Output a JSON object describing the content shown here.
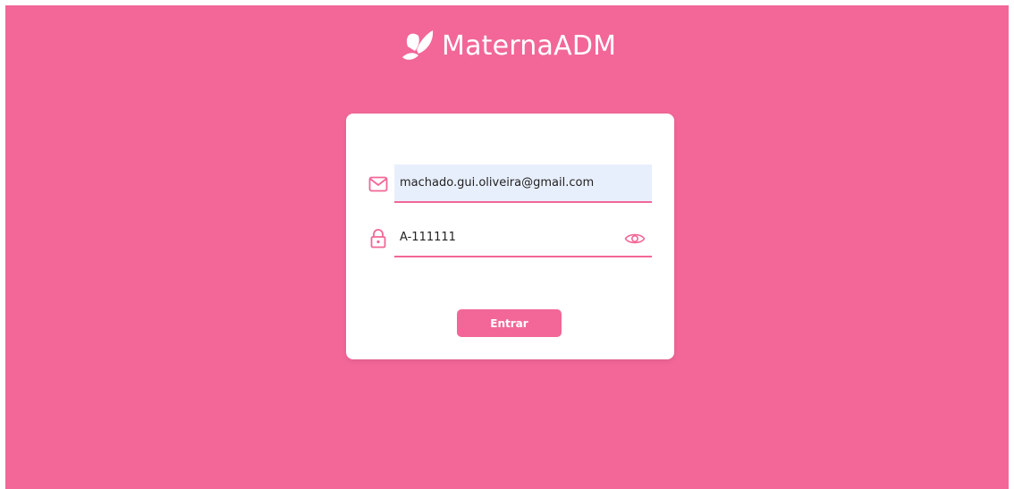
{
  "brand": {
    "name": "MaternaADM",
    "logo_icon": "butterfly-icon"
  },
  "colors": {
    "background": "#f26797",
    "card": "#ffffff",
    "accent": "#f26797",
    "autofill": "#e8effc"
  },
  "login": {
    "email": {
      "icon": "mail-icon",
      "value": "machado.gui.oliveira@gmail.com"
    },
    "password": {
      "icon": "lock-icon",
      "value": "A-111111",
      "toggle_icon": "eye-icon"
    },
    "submit_label": "Entrar"
  }
}
